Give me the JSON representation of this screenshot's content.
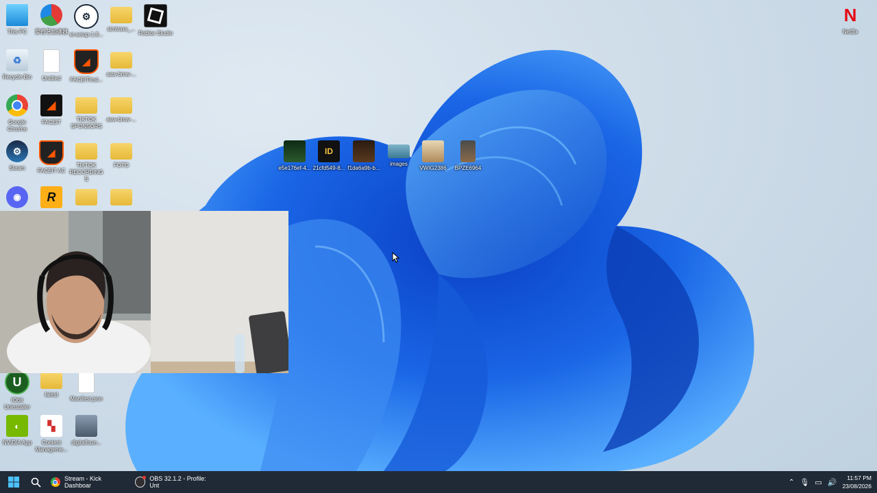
{
  "desktop_icons": [
    {
      "label": "This PC",
      "icon": "monitor-icon"
    },
    {
      "label": "爱奇艺加速器",
      "icon": "app-icon"
    },
    {
      "label": "st-setup-1.8...",
      "icon": "steam-setup-icon"
    },
    {
      "label": "simtraxx_...",
      "icon": "folder-icon"
    },
    {
      "label": "Roblox Studio",
      "icon": "roblox-icon"
    },
    {
      "label": "Recycle Bin",
      "icon": "recycle-bin-icon"
    },
    {
      "label": "Untitled",
      "icon": "document-icon"
    },
    {
      "label": "FACEITInst...",
      "icon": "faceit-ac-icon"
    },
    {
      "label": "asw-bmw-...",
      "icon": "folder-icon"
    },
    {
      "label": "Google Chrome",
      "icon": "chrome-icon"
    },
    {
      "label": "FACEIT",
      "icon": "faceit-icon"
    },
    {
      "label": "TIKTOK SPONSORS",
      "icon": "folder-icon"
    },
    {
      "label": "asw-bmw-...",
      "icon": "folder-icon"
    },
    {
      "label": "Steam",
      "icon": "steam-icon"
    },
    {
      "label": "FACEIT AC",
      "icon": "faceit-ac-icon"
    },
    {
      "label": "TIKTOK RECORDINGS",
      "icon": "folder-icon"
    },
    {
      "label": "FOTO",
      "icon": "folder-icon"
    },
    {
      "label": "",
      "icon": "discord-icon"
    },
    {
      "label": "",
      "icon": "rockstar-icon"
    },
    {
      "label": "",
      "icon": "folder-icon"
    },
    {
      "label": "",
      "icon": "folder-icon"
    },
    {
      "label": "IObit Uninstaller",
      "icon": "iobit-icon"
    },
    {
      "label": "latest",
      "icon": "folder-icon"
    },
    {
      "label": "Manifest.json",
      "icon": "document-icon"
    },
    {
      "label": "NVIDIA App",
      "icon": "nvidia-icon"
    },
    {
      "label": "Content Manageme...",
      "icon": "content-manager-icon"
    },
    {
      "label": "digitalfoun...",
      "icon": "image-icon"
    },
    {
      "label": "e5e176ef-4...",
      "icon": "image-icon"
    },
    {
      "label": "21cfd549-8...",
      "icon": "image-icon"
    },
    {
      "label": "f1da6a9b-b...",
      "icon": "image-icon"
    },
    {
      "label": "images",
      "icon": "image-icon"
    },
    {
      "label": "VWIG2386",
      "icon": "image-icon"
    },
    {
      "label": "BPZE6964",
      "icon": "image-icon"
    },
    {
      "label": "Netflix",
      "icon": "netflix-icon"
    }
  ],
  "taskbar": {
    "apps": [
      {
        "label": "Stream - Kick Dashboar",
        "icon": "chrome-icon"
      },
      {
        "label": "OBS 32.1.2 - Profile: Unt",
        "icon": "obs-icon"
      }
    ],
    "clock": {
      "time": "11:57 PM",
      "date": "23/08/2026"
    }
  },
  "colors": {
    "taskbar": "#202a36",
    "wallpaper_blue": "#1f6fe0",
    "netflix": "#e50914"
  }
}
